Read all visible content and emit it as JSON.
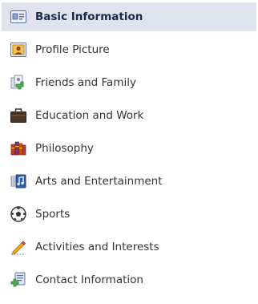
{
  "nav": {
    "items": [
      {
        "label": "Basic Information",
        "icon": "id-card-icon",
        "active": true
      },
      {
        "label": "Profile Picture",
        "icon": "portrait-icon",
        "active": false
      },
      {
        "label": "Friends and Family",
        "icon": "friends-icon",
        "active": false
      },
      {
        "label": "Education and Work",
        "icon": "briefcase-icon",
        "active": false
      },
      {
        "label": "Philosophy",
        "icon": "books-icon",
        "active": false
      },
      {
        "label": "Arts and Entertainment",
        "icon": "music-note-icon",
        "active": false
      },
      {
        "label": "Sports",
        "icon": "soccer-ball-icon",
        "active": false
      },
      {
        "label": "Activities and Interests",
        "icon": "pencil-icon",
        "active": false
      },
      {
        "label": "Contact Information",
        "icon": "contact-card-icon",
        "active": false
      }
    ]
  },
  "colors": {
    "active_background": "#dfe3ee",
    "text": "#333333",
    "active_text": "#1c2a47"
  }
}
